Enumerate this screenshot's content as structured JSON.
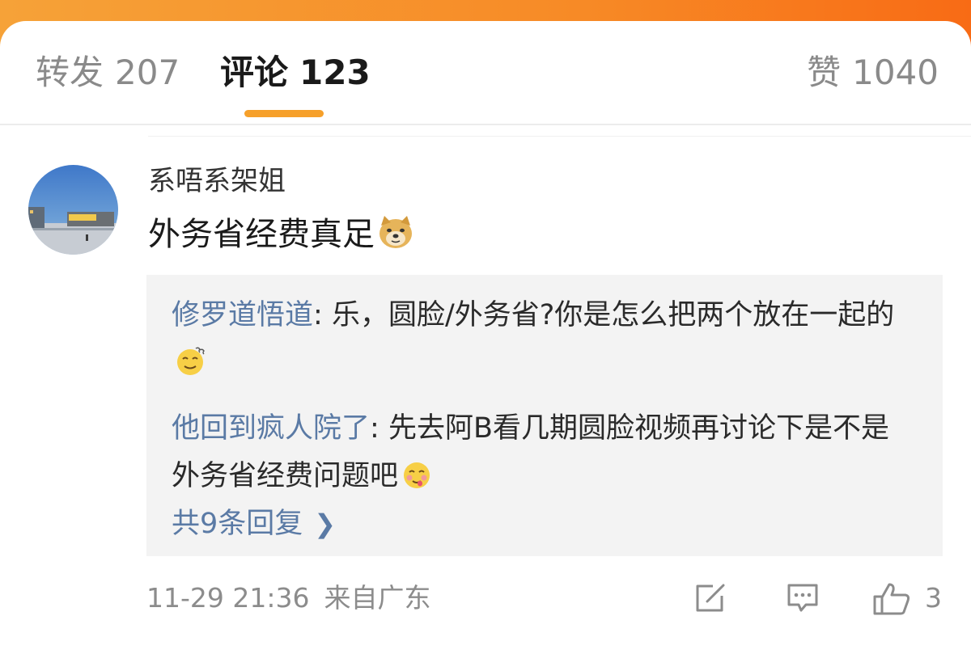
{
  "tabs": {
    "forward": {
      "label": "转发",
      "count": "207"
    },
    "comment": {
      "label": "评论",
      "count": "123"
    },
    "like": {
      "label": "赞",
      "count": "1040"
    }
  },
  "comment": {
    "username": "系唔系架姐",
    "text": "外务省经费真足",
    "text_emoji": "doge-icon",
    "replies": [
      {
        "name": "修罗道悟道",
        "sep": ": ",
        "text": "乐，圆脸/外务省?你是怎么把两个放在一起的",
        "emoji": "dizzy-face-icon"
      },
      {
        "name": "他回到疯人院了",
        "sep": ": ",
        "text": "先去阿B看几期圆脸视频再讨论下是不是外务省经费问题吧",
        "emoji": "yummy-face-icon"
      }
    ],
    "more_replies": "共9条回复",
    "timestamp": "11-29 21:36",
    "location": "来自广东",
    "like_count": "3"
  },
  "colors": {
    "header_gradient_start": "#f6a238",
    "header_gradient_end": "#f86b15",
    "tab_indicator": "#f6a02a",
    "link_blue": "#5a7aa5",
    "reply_bg": "#f3f3f3",
    "muted_text": "#8c8c8c"
  }
}
